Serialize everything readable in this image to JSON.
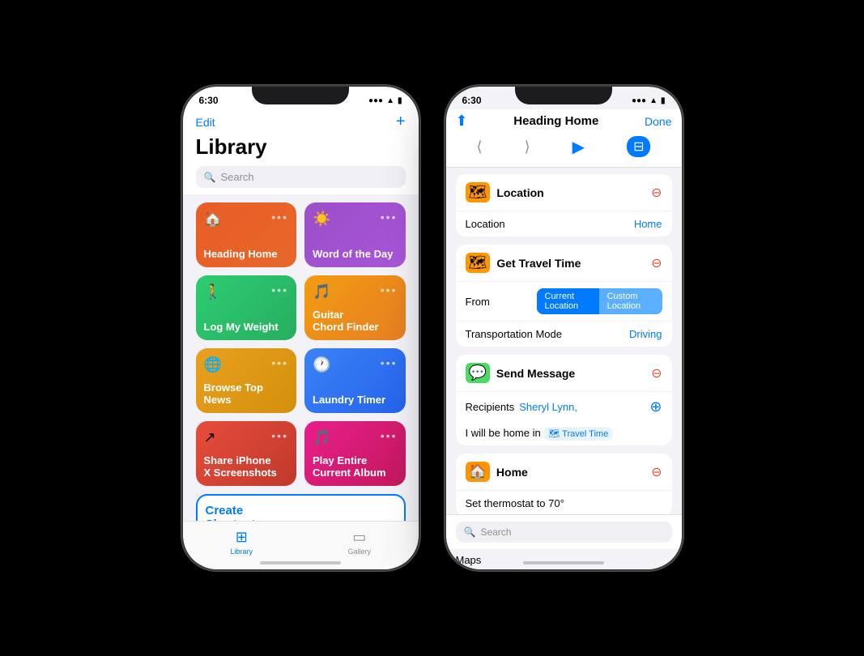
{
  "left_phone": {
    "status": {
      "time": "6:30",
      "signal": "▂▄▆█",
      "wifi": "WiFi",
      "battery": "🔋"
    },
    "header": {
      "edit_label": "Edit",
      "add_label": "+",
      "title": "Library",
      "search_placeholder": "Search"
    },
    "tiles": [
      {
        "id": "heading-home",
        "label": "Heading Home",
        "icon": "🏠",
        "bg": "linear-gradient(135deg, #e85d26, #e8672a)"
      },
      {
        "id": "word-of-the-day",
        "label": "Word of the Day",
        "icon": "☀️",
        "bg": "linear-gradient(135deg, #9b4fc8, #a855d8)"
      },
      {
        "id": "log-my-weight",
        "label": "Log My Weight",
        "icon": "🚶",
        "bg": "linear-gradient(135deg, #2ecc71, #27ae60)"
      },
      {
        "id": "guitar-chord-finder",
        "label": "Guitar\nChord Finder",
        "icon": "🎵",
        "bg": "linear-gradient(135deg, #f39c12, #e67e22)"
      },
      {
        "id": "browse-top-news",
        "label": "Browse Top News",
        "icon": "🌐",
        "bg": "linear-gradient(135deg, #e8a020, #d4900a)"
      },
      {
        "id": "laundry-timer",
        "label": "Laundry Timer",
        "icon": "🕐",
        "bg": "linear-gradient(135deg, #3b82f6, #2563eb)"
      },
      {
        "id": "share-iphone",
        "label": "Share iPhone\nX Screenshots",
        "icon": "↗",
        "bg": "linear-gradient(135deg, #e74c3c, #c0392b)"
      },
      {
        "id": "play-album",
        "label": "Play Entire\nCurrent Album",
        "icon": "🎵",
        "bg": "linear-gradient(135deg, #e91e8c, #c2185b)"
      }
    ],
    "create_shortcut": {
      "label": "Create\nShortcut",
      "plus": "+"
    },
    "nav": {
      "library_icon": "⊞",
      "library_label": "Library",
      "gallery_icon": "▭",
      "gallery_label": "Gallery"
    }
  },
  "right_phone": {
    "status": {
      "time": "6:30"
    },
    "header": {
      "share_icon": "⬆",
      "title": "Heading Home",
      "done_label": "Done"
    },
    "toolbar": {
      "back_icon": "⟨",
      "fwd_icon": "⟩",
      "play_icon": "▶",
      "toggle_icon": "⊟"
    },
    "actions": [
      {
        "id": "location",
        "title": "Location",
        "icon": "🗺",
        "icon_color": "#ff9500",
        "rows": [
          {
            "label": "Location",
            "value": "Home",
            "value_color": "#007aff",
            "type": "value"
          }
        ]
      },
      {
        "id": "get-travel-time",
        "title": "Get Travel Time",
        "icon": "🗺",
        "icon_color": "#ff9500",
        "rows": [
          {
            "label": "From",
            "type": "segment",
            "options": [
              "Current Location",
              "Custom Location"
            ]
          },
          {
            "label": "Transportation Mode",
            "value": "Driving",
            "value_color": "#007aff",
            "type": "value"
          }
        ]
      },
      {
        "id": "send-message",
        "title": "Send Message",
        "icon": "💬",
        "icon_color": "#4cd964",
        "rows": [
          {
            "label": "Recipients",
            "value": "Sheryl Lynn,",
            "value_color": "#007aff",
            "type": "recipients"
          },
          {
            "label": "message",
            "type": "message",
            "text": "I will be home in",
            "badge": "🗺 Travel Time"
          }
        ]
      },
      {
        "id": "home",
        "title": "Home",
        "icon": "🏠",
        "icon_color": "#ff9500",
        "rows": [
          {
            "label": "set_label",
            "type": "text",
            "text": "Set thermostat to 70°"
          }
        ]
      }
    ],
    "bottom": {
      "search_placeholder": "Search",
      "maps_label": "Maps"
    }
  }
}
